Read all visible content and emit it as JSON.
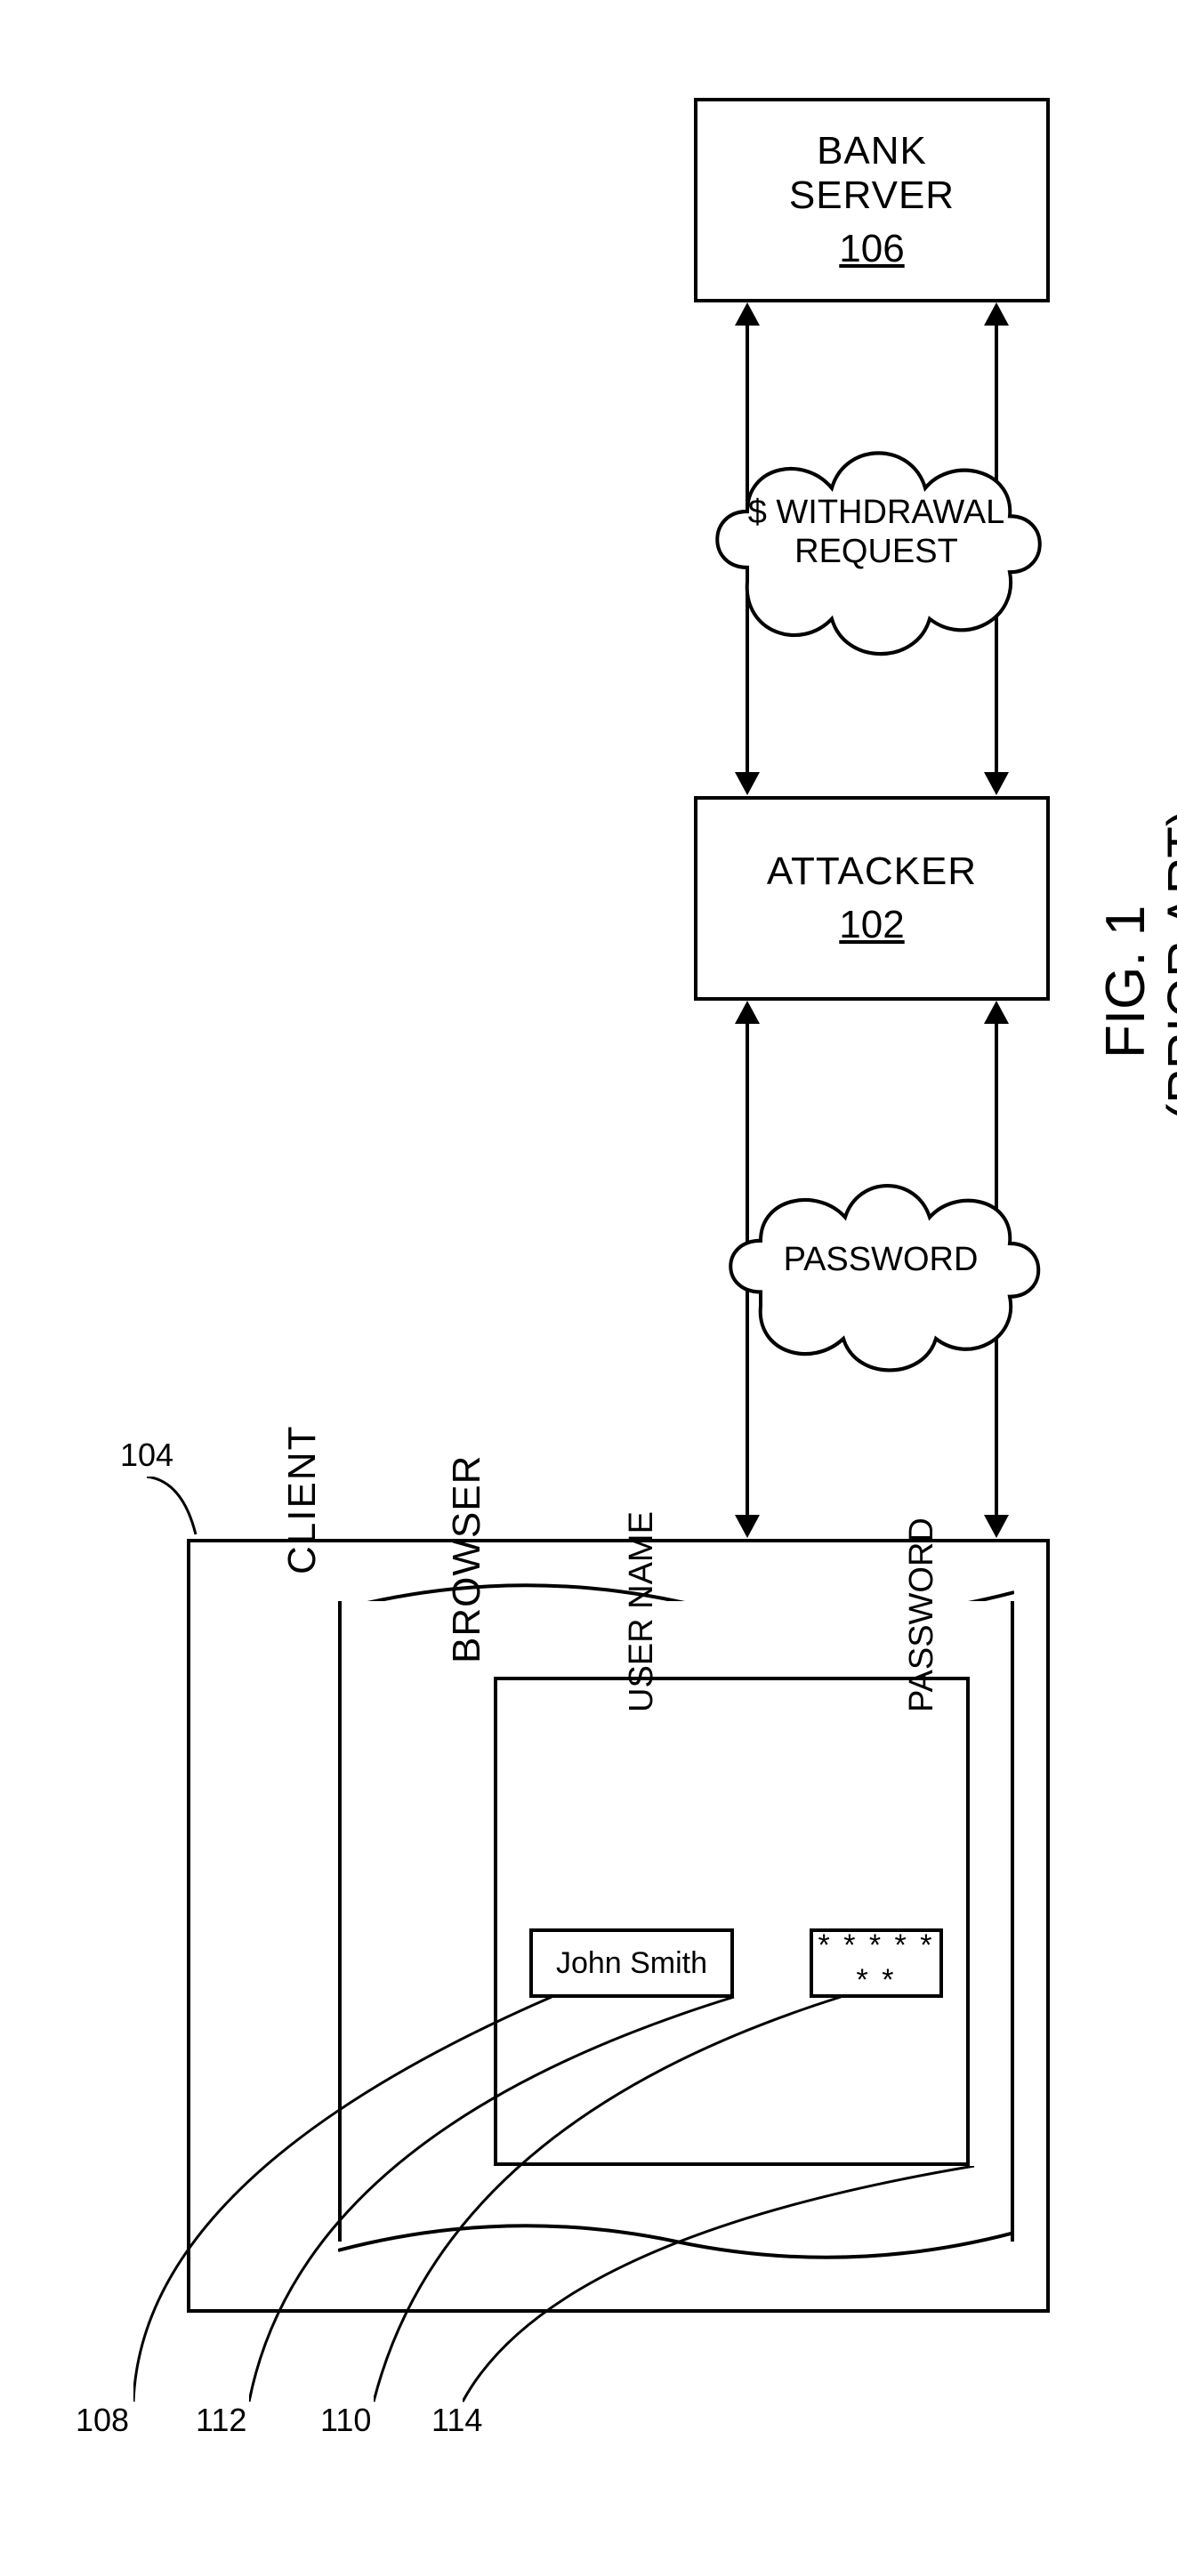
{
  "figure": {
    "number": "FIG. 1",
    "subtitle": "(PRIOR ART)"
  },
  "blocks": {
    "bankServer": {
      "label": "BANK\nSERVER",
      "ref": "106"
    },
    "attacker": {
      "label": "ATTACKER",
      "ref": "102"
    },
    "client": {
      "label": "CLIENT",
      "ref": "104"
    }
  },
  "clouds": {
    "withdrawal": "$ WITHDRAWAL\nREQUEST",
    "password": "PASSWORD"
  },
  "browser": {
    "label": "BROWSER",
    "userNameLabel": "USER NAME",
    "userNameValue": "John Smith",
    "passwordLabel": "PASSWORD",
    "passwordValue": "* * * * * * *"
  },
  "callouts": {
    "c104": "104",
    "c108": "108",
    "c112": "112",
    "c110": "110",
    "c114": "114"
  }
}
